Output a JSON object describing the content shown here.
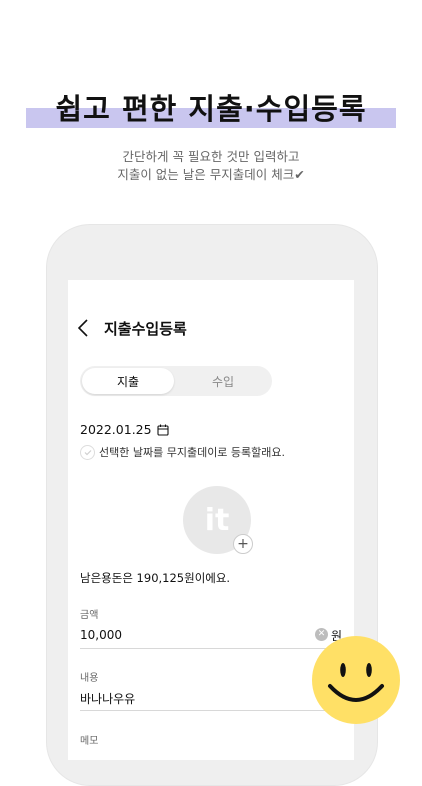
{
  "headline": "쉽고 편한 지출·수입등록",
  "subtitle": {
    "line1": "간단하게 꼭 필요한 것만 입력하고",
    "line2": "지출이 없는 날은 무지출데이 체크✔"
  },
  "screen": {
    "nav_title": "지출수입등록",
    "tabs": {
      "expense": "지출",
      "income": "수입",
      "selected": "지출"
    },
    "date": "2022.01.25",
    "no_spend_label": "선택한 날짜를 무지출데이로 등록할래요.",
    "avatar_text": "it",
    "avatar_add": "+",
    "balance_text": "남은용돈은 190,125원이에요.",
    "amount": {
      "label": "금액",
      "value": "10,000",
      "unit": "원"
    },
    "content": {
      "label": "내용",
      "value": "바나나우유"
    },
    "memo": {
      "label": "메모"
    }
  },
  "colors": {
    "highlight": "#c9c6ef",
    "smiley": "#ffe066",
    "phone_frame": "#efefef"
  },
  "icons": [
    "chevron-left-icon",
    "calendar-icon",
    "check-icon",
    "plus-icon",
    "clear-icon",
    "smiley-icon"
  ]
}
